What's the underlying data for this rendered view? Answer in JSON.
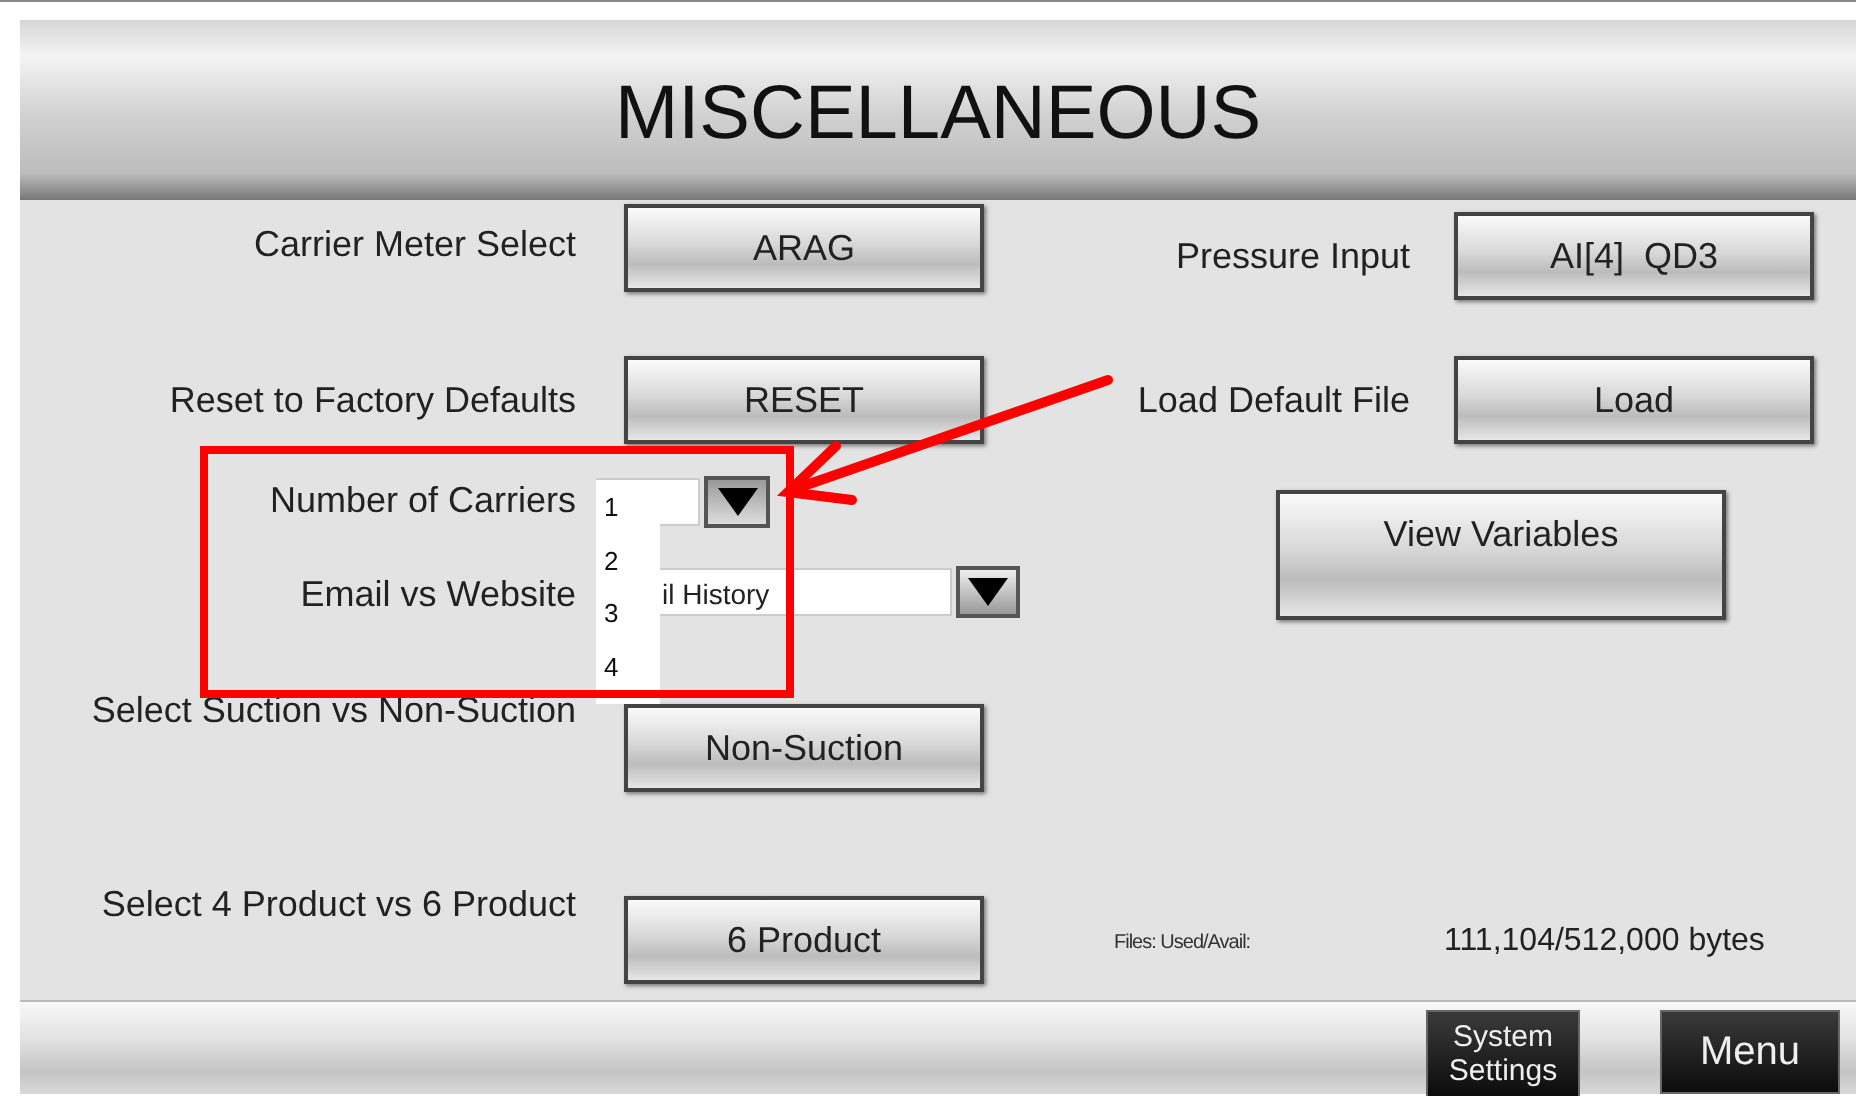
{
  "title": "MISCELLANEOUS",
  "left_settings": [
    {
      "kind": "button",
      "label": "Carrier Meter Select",
      "value": "ARAG"
    },
    {
      "kind": "button",
      "label": "Reset to Factory Defaults",
      "value": "RESET"
    },
    {
      "kind": "dropdown",
      "label": "Number of Carriers",
      "expanded": true,
      "options": [
        {
          "label": "1",
          "selected": false
        },
        {
          "label": "2",
          "selected": false
        },
        {
          "label": "3",
          "selected": false
        },
        {
          "label": "4",
          "selected": false
        }
      ]
    },
    {
      "kind": "dropdown",
      "label": "Email vs Website",
      "value": "il History",
      "expanded": false
    },
    {
      "kind": "button",
      "label": "Select Suction vs Non-Suction",
      "value": "Non-Suction"
    },
    {
      "kind": "button",
      "label": "Select 4 Product vs 6 Product",
      "value": "6 Product"
    }
  ],
  "right_settings": [
    {
      "kind": "button",
      "label": "Pressure Input",
      "value": "AI[4]  QD3"
    },
    {
      "kind": "button",
      "label": "Load Default File",
      "value": "Load"
    },
    {
      "kind": "tall_button",
      "value": "View Variables"
    }
  ],
  "files": {
    "label": "Files: Used/Avail:",
    "value": "111,104/512,000 bytes"
  },
  "nav_buttons": [
    "System Settings",
    "Menu"
  ]
}
